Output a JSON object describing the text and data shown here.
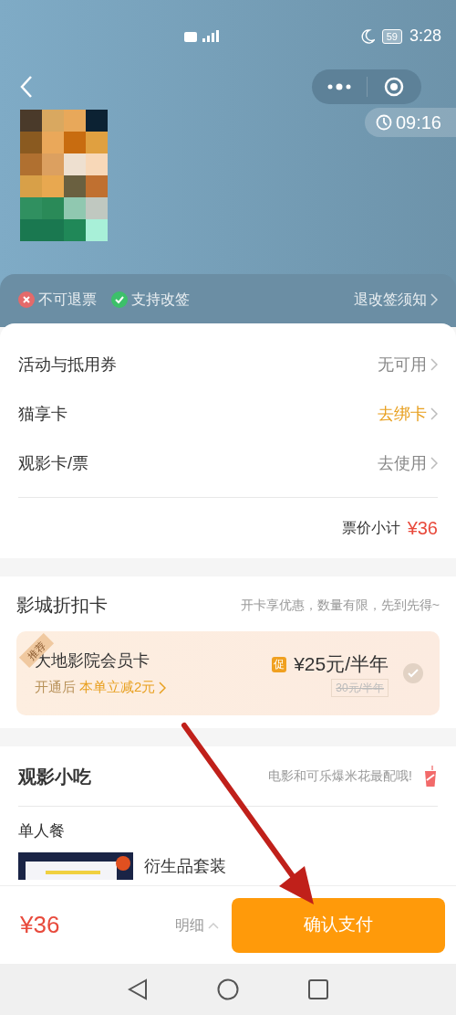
{
  "status_bar": {
    "battery": "59",
    "time": "3:28"
  },
  "timer": "09:16",
  "policy": {
    "items": [
      {
        "label": "不可退票",
        "kind": "no"
      },
      {
        "label": "支持改签",
        "kind": "yes"
      }
    ],
    "notice": "退改签须知"
  },
  "options": [
    {
      "label": "活动与抵用券",
      "value": "无可用",
      "highlight": false
    },
    {
      "label": "猫享卡",
      "value": "去绑卡",
      "highlight": true
    },
    {
      "label": "观影卡/票",
      "value": "去使用",
      "highlight": false
    }
  ],
  "subtotal": {
    "label": "票价小计",
    "amount": "¥36"
  },
  "discount": {
    "title": "影城折扣卡",
    "hint": "开卡享优惠，数量有限，先到先得~",
    "card": {
      "badge": "推荐",
      "name": "大地影院会员卡",
      "sub": "开通后",
      "sub_highlight": "本单立减2元",
      "promo": "促",
      "price": "¥25元/半年",
      "original": "30元/半年",
      "selected": false
    }
  },
  "snacks": {
    "title": "观影小吃",
    "hint": "电影和可乐爆米花最配哦!",
    "subtitle": "单人餐",
    "items": [
      {
        "name": "衍生品套装"
      }
    ]
  },
  "footer": {
    "total": "¥36",
    "detail": "明细",
    "pay": "确认支付"
  }
}
